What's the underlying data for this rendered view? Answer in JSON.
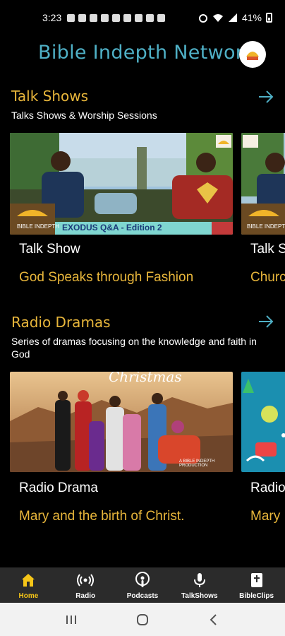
{
  "status_bar": {
    "time": "3:23",
    "battery": "41%"
  },
  "header": {
    "title": "Bible Indepth Network"
  },
  "sections": [
    {
      "title": "Talk Shows",
      "subtitle": "Talks Shows & Worship Sessions",
      "cards": [
        {
          "type": "Talk Show",
          "title": "God Speaks through Fashion",
          "thumb_caption": "EXODUS Q&A - Edition 2",
          "badge": "BIBLE INDEPTH"
        },
        {
          "type": "Talk Show",
          "title": "Church",
          "badge": "BIBLE INDEPTH"
        }
      ]
    },
    {
      "title": "Radio Dramas",
      "subtitle": "Series of dramas focusing on the knowledge and faith in God",
      "cards": [
        {
          "type": "Radio Drama",
          "title": "Mary and the birth of Christ.",
          "thumb_caption": "Christmas",
          "credit": "A BIBLE INDEPTH PRODUCTION"
        },
        {
          "type": "Radio",
          "title": "Mary"
        }
      ]
    }
  ],
  "bottom_nav": [
    {
      "label": "Home",
      "icon": "home-icon",
      "active": true
    },
    {
      "label": "Radio",
      "icon": "radio-broadcast-icon",
      "active": false
    },
    {
      "label": "Podcasts",
      "icon": "podcast-icon",
      "active": false
    },
    {
      "label": "TalkShows",
      "icon": "microphone-icon",
      "active": false
    },
    {
      "label": "BibleClips",
      "icon": "bible-icon",
      "active": false
    }
  ],
  "colors": {
    "accent_gold": "#e8b63b",
    "title_teal": "#4fb0c6",
    "active_nav": "#f5c518",
    "nav_bg": "#2b2b2b"
  }
}
